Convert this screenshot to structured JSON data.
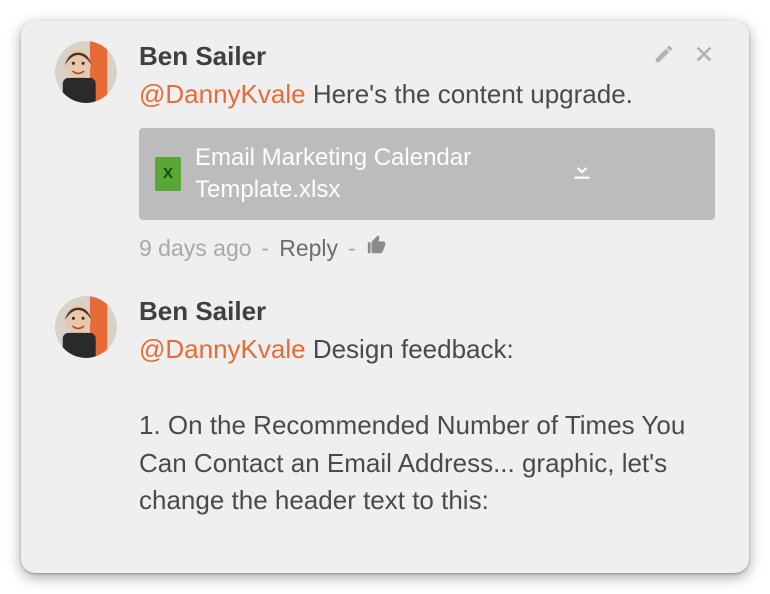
{
  "comments": [
    {
      "author": "Ben Sailer",
      "mention": "@DannyKvale",
      "text": " Here's the content upgrade.",
      "attachment": {
        "name": "Email Marketing Calendar Template.xlsx"
      },
      "age": "9 days ago",
      "reply_label": "Reply",
      "show_actions": true
    },
    {
      "author": "Ben Sailer",
      "mention": "@DannyKvale",
      "text": " Design feedback:",
      "extra": "1. On the Recommended Number of Times You Can Contact an Email Address... graphic, let's change the header text to this:",
      "show_actions": false
    }
  ],
  "sep": " - "
}
